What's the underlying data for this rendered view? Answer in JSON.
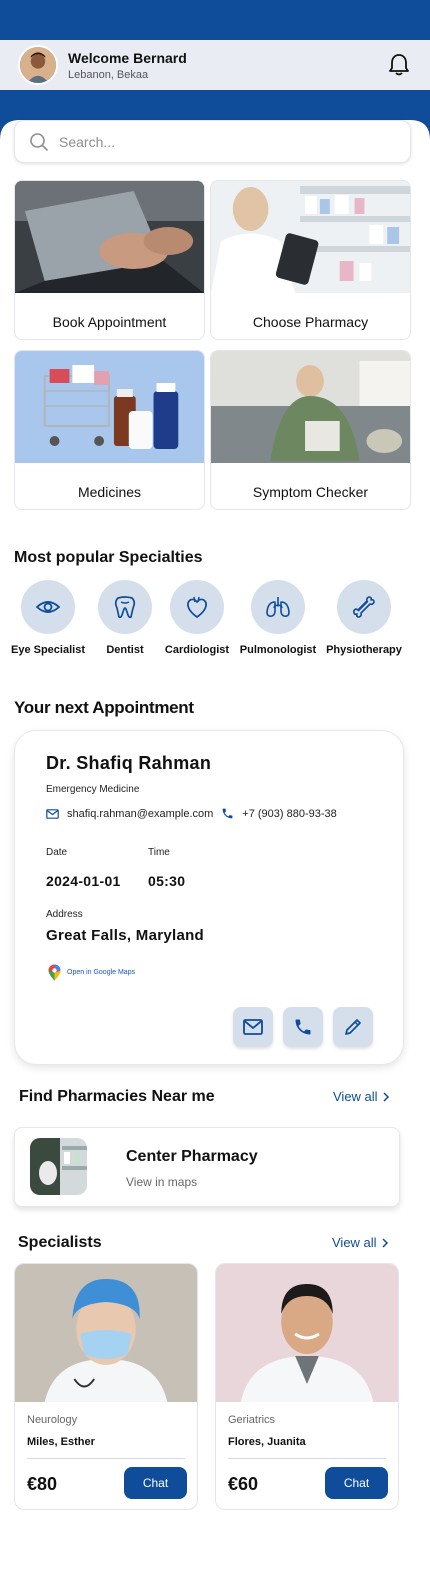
{
  "header": {
    "welcome": "Welcome Bernard",
    "location": "Lebanon, Bekaa",
    "avatar_icon": "user-avatar",
    "bell_icon": "bell-icon"
  },
  "search": {
    "placeholder": "Search..."
  },
  "tiles": [
    {
      "label": "Book Appointment",
      "icon": "laptop-image"
    },
    {
      "label": "Choose Pharmacy",
      "icon": "pharmacy-image"
    },
    {
      "label": "Medicines",
      "icon": "medicines-image"
    },
    {
      "label": "Symptom Checker",
      "icon": "sick-person-image"
    }
  ],
  "specialties": {
    "title": "Most popular Specialties",
    "items": [
      {
        "label": "Eye Specialist",
        "icon": "eye-icon"
      },
      {
        "label": "Dentist",
        "icon": "tooth-icon"
      },
      {
        "label": "Cardiologist",
        "icon": "heart-icon"
      },
      {
        "label": "Pulmonologist",
        "icon": "lungs-icon"
      },
      {
        "label": "Physiotherapy",
        "icon": "bone-icon"
      }
    ]
  },
  "appointment": {
    "title": "Your next Appointment",
    "doctor": "Dr. Shafiq Rahman",
    "department": "Emergency Medicine",
    "email": "shafiq.rahman@example.com",
    "phone": "+7 (903) 880-93-38",
    "date_label": "Date",
    "date": "2024-01-01",
    "time_label": "Time",
    "time": "05:30",
    "address_label": "Address",
    "address": "Great Falls, Maryland",
    "maps_link": "Open in Google Maps"
  },
  "pharmacies": {
    "title": "Find Pharmacies Near me",
    "view_all": "View all",
    "item": {
      "name": "Center Pharmacy",
      "link": "View in maps"
    }
  },
  "specialists": {
    "title": "Specialists",
    "view_all": "View all",
    "items": [
      {
        "category": "Neurology",
        "name": "Miles, Esther",
        "price": "€80",
        "chat": "Chat"
      },
      {
        "category": "Geriatrics",
        "name": "Flores, Juanita",
        "price": "€60",
        "chat": "Chat"
      }
    ]
  },
  "colors": {
    "primary": "#0f4c99",
    "icon_bg": "#d5dfec",
    "header_bg": "#e9edf3"
  }
}
